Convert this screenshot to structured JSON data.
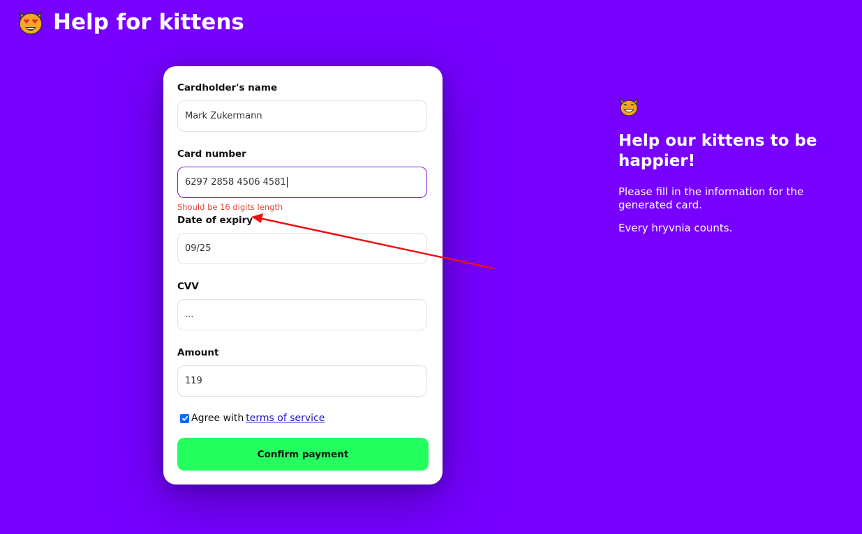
{
  "header": {
    "logo_icon": "heart-eyes-cat-icon",
    "title": "Help for kittens"
  },
  "form": {
    "fields": [
      {
        "label": "Cardholder's name",
        "value": "Mark Zukermann"
      },
      {
        "label": "Card number",
        "value": "6297 2858 4506 4581",
        "error": "Should be 16 digits length"
      },
      {
        "label": "Date of expiry",
        "value": "09/25"
      },
      {
        "label": "CVV",
        "value": "..."
      },
      {
        "label": "Amount",
        "value": "119"
      }
    ],
    "agree": {
      "checked": true,
      "text": "Agree with",
      "link_text": "terms of service"
    },
    "confirm_label": "Confirm payment"
  },
  "promo": {
    "icon": "grinning-cat-icon",
    "title": "Help our kittens to be happier!",
    "text": "Please fill in the information for the generated card.",
    "text2": "Every hryvnia counts."
  },
  "colors": {
    "background": "#7700ff",
    "card": "#ffffff",
    "confirm_button": "#22ff5f",
    "error": "#e04a3b",
    "link": "#1a12c8",
    "annotation_arrow": "#ee1111"
  }
}
